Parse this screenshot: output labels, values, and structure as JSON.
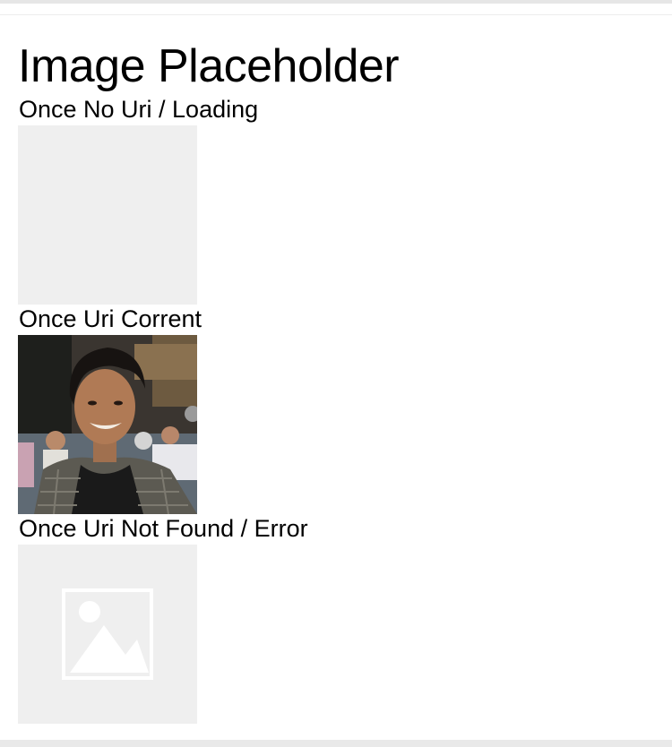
{
  "page": {
    "title": "Image Placeholder"
  },
  "sections": [
    {
      "label": "Once No Uri / Loading",
      "state": "loading"
    },
    {
      "label": "Once Uri Corrent",
      "state": "image"
    },
    {
      "label": "Once Uri Not Found / Error",
      "state": "error"
    }
  ],
  "icons": {
    "error_placeholder": "image-placeholder-icon",
    "photo": "person-photo"
  },
  "colors": {
    "placeholder_bg": "#efefef",
    "placeholder_icon": "#ffffff"
  }
}
